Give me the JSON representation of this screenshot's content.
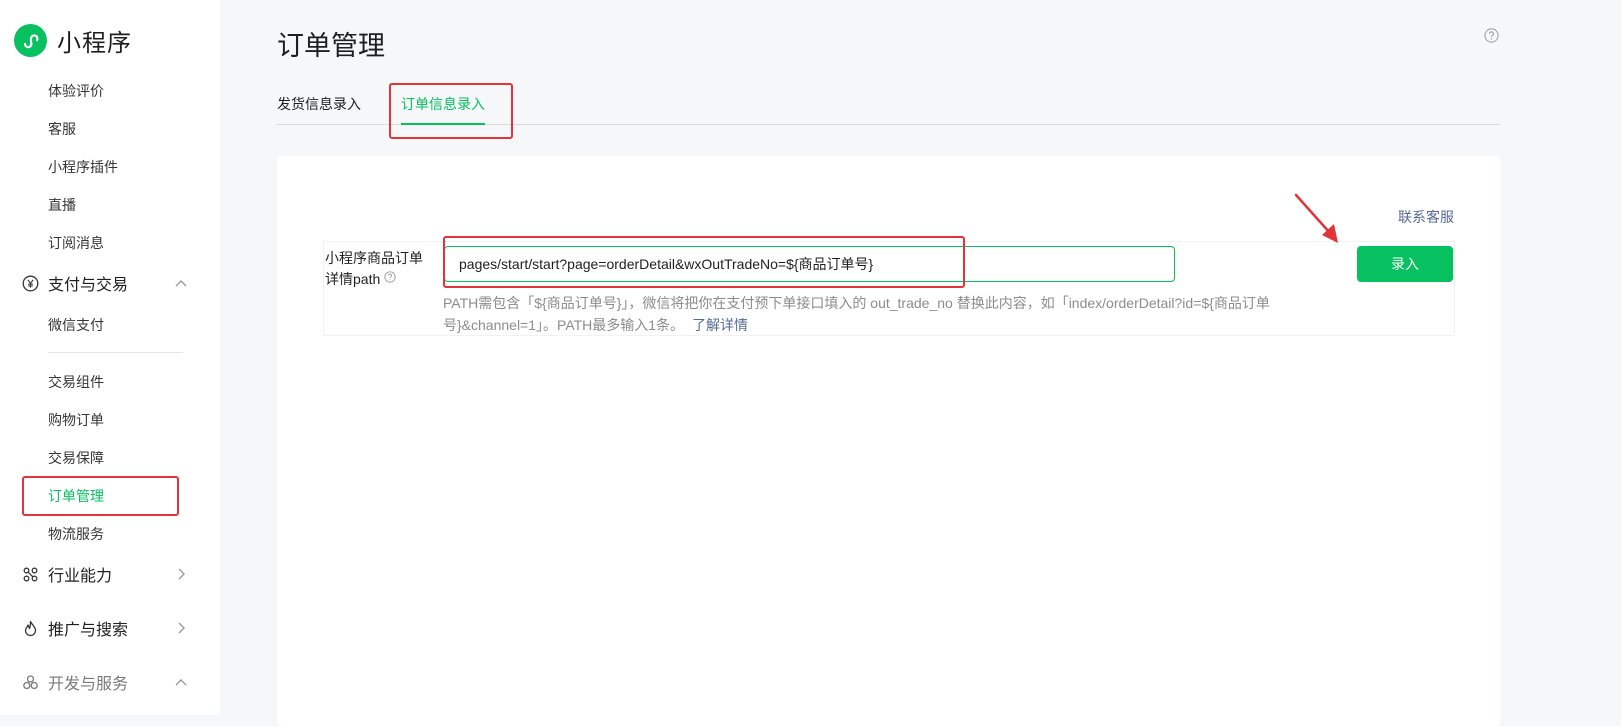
{
  "brand": {
    "name": "小程序",
    "logo_icon": "mini-program-logo-icon",
    "accent_color": "#07c160"
  },
  "sidebar": {
    "top_items": [
      {
        "label": "体验评价"
      },
      {
        "label": "客服"
      },
      {
        "label": "小程序插件"
      },
      {
        "label": "直播"
      },
      {
        "label": "订阅消息"
      }
    ],
    "groups": {
      "payment": {
        "label": "支付与交易",
        "icon": "yuan-icon",
        "expanded": true,
        "items": [
          {
            "label": "微信支付"
          },
          {
            "label": "交易组件"
          },
          {
            "label": "购物订单"
          },
          {
            "label": "交易保障"
          },
          {
            "label": "订单管理",
            "active": true
          },
          {
            "label": "物流服务"
          }
        ]
      },
      "industry": {
        "label": "行业能力",
        "icon": "nodes-icon",
        "expanded": false
      },
      "promotion": {
        "label": "推广与搜索",
        "icon": "flame-icon",
        "expanded": false
      },
      "dev": {
        "label": "开发与服务",
        "icon": "circles-icon",
        "expanded": true
      }
    }
  },
  "page": {
    "title": "订单管理",
    "tabs": [
      {
        "label": "发货信息录入",
        "active": false
      },
      {
        "label": "订单信息录入",
        "active": true
      }
    ]
  },
  "form": {
    "contact_link": "联系客服",
    "label_line1": "小程序商品订单",
    "label_line2": "详情path",
    "input_value": "pages/start/start?page=orderDetail&wxOutTradeNo=${商品订单号}",
    "hint_text": "PATH需包含「${商品订单号}」，微信将把你在支付预下单接口填入的 out_trade_no 替换此内容，如「index/orderDetail?id=${商品订单号}&channel=1」。PATH最多输入1条。",
    "hint_link": "了解详情",
    "submit_label": "录入"
  },
  "annotation_color": "#e1353b"
}
